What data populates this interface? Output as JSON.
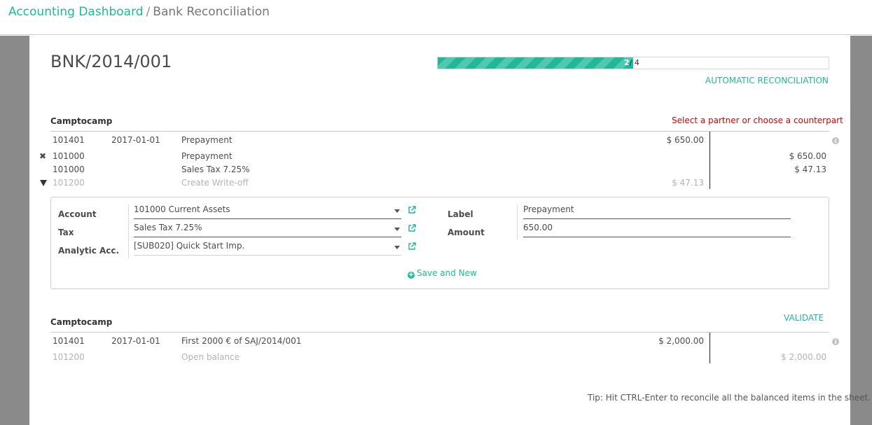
{
  "breadcrumb": {
    "parent": "Accounting Dashboard",
    "separator": "/",
    "current": "Bank Reconciliation"
  },
  "statement": {
    "title": "BNK/2014/001",
    "progress": {
      "done": "2",
      "sep": "/",
      "total": "4",
      "fraction": 0.5
    },
    "auto_label": "AUTOMATIC RECONCILIATION"
  },
  "line1": {
    "partner": "Camptocamp",
    "warning": "Select a partner or choose a counterpart",
    "main": {
      "account": "101401",
      "date": "2017-01-01",
      "label": "Prepayment",
      "debit": "$ 650.00"
    },
    "rows": [
      {
        "account": "101000",
        "label": "Prepayment",
        "credit": "$ 650.00"
      },
      {
        "account": "101000",
        "label": "Sales Tax 7.25%",
        "credit": "$ 47.13"
      }
    ],
    "writeoff": {
      "account": "101200",
      "label": "Create Write-off",
      "debit": "$ 47.13"
    }
  },
  "form": {
    "account_label": "Account",
    "account_value": "101000 Current Assets",
    "tax_label": "Tax",
    "tax_value": "Sales Tax 7.25%",
    "analytic_label": "Analytic Acc.",
    "analytic_value": "[SUB020] Quick Start Imp.",
    "label_label": "Label",
    "label_value": "Prepayment",
    "amount_label": "Amount",
    "amount_value": "650.00",
    "save_label": "Save and New"
  },
  "line2": {
    "partner": "Camptocamp",
    "validate_label": "VALIDATE",
    "main": {
      "account": "101401",
      "date": "2017-01-01",
      "label": "First 2000 € of SAJ/2014/001",
      "debit": "$ 2,000.00"
    },
    "open": {
      "account": "101200",
      "label": "Open balance",
      "credit": "$ 2,000.00"
    }
  },
  "tip": "Tip: Hit CTRL-Enter to reconcile all the balanced items in the sheet.",
  "colors": {
    "accent": "#21b799",
    "warning": "#d60000"
  },
  "icons": {
    "external": "external-link-icon",
    "info": "info-icon",
    "remove": "remove-icon",
    "toggle": "triangle-down-icon",
    "add": "plus-circle-icon"
  }
}
